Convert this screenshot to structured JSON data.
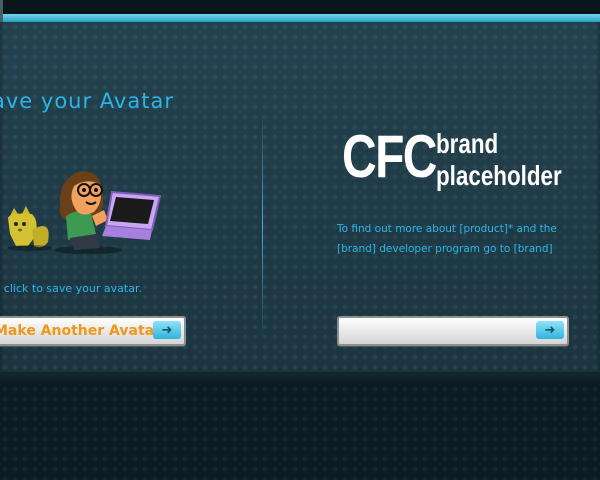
{
  "left_panel": {
    "title": "ave your Avatar",
    "instruction": "t click to save your avatar.",
    "make_another_label": "Make Another Avatar"
  },
  "right_panel": {
    "brand_cfc": "CFC",
    "brand_line1": "brand",
    "brand_line2": "placeholder",
    "info_line1": "To find out more about [product]* and the",
    "info_line2": "[brand] developer program go to [brand]",
    "link_button_label": ""
  },
  "icons": {
    "arrow": "arrow-right-icon",
    "avatar": "avatar-illustration"
  },
  "colors": {
    "accent_blue": "#2bb5e6",
    "button_text_orange": "#f0971c",
    "panel_bg": "#1f3a46"
  }
}
